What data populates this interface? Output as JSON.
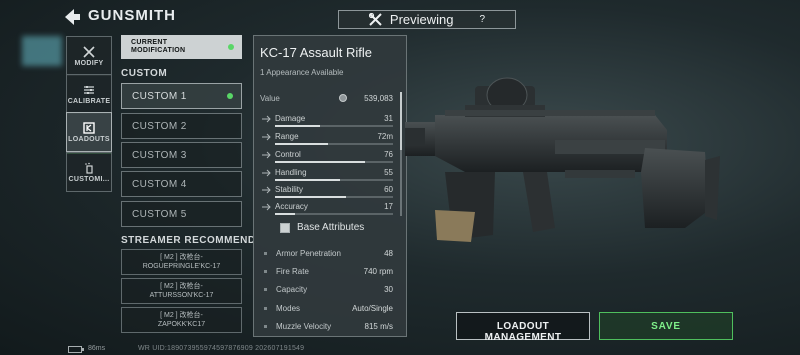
{
  "header": {
    "title": "GUNSMITH",
    "preview_label": "Previewing",
    "help_label": "?"
  },
  "nav": [
    {
      "label": "MODIFY",
      "icon": "wrench-icon"
    },
    {
      "label": "CALIBRATE",
      "icon": "sliders-icon"
    },
    {
      "label": "LOADOUTS",
      "icon": "loadout-icon"
    },
    {
      "label": "CUSTOMI...",
      "icon": "spray-icon"
    }
  ],
  "current_modification": {
    "line1": "CURRENT",
    "line2": "MODIFICATION"
  },
  "custom_section": {
    "label": "CUSTOM",
    "items": [
      "CUSTOM 1",
      "CUSTOM 2",
      "CUSTOM 3",
      "CUSTOM 4",
      "CUSTOM 5"
    ]
  },
  "streamer_section": {
    "label": "STREAMER RECOMMENDAT",
    "items": [
      {
        "line1": "[ M2 ] 改枪台-",
        "line2": "ROGUEPRINGLE'KC-17"
      },
      {
        "line1": "[ M2 ] 改枪台-",
        "line2": "ATTURSSON'KC-17"
      },
      {
        "line1": "[ M2 ] 改枪台-",
        "line2": "ZAPOKK'KC17"
      }
    ]
  },
  "weapon": {
    "name": "KC-17 Assault Rifle",
    "appearance": "1 Appearance Available",
    "value_label": "Value",
    "value": "539,083"
  },
  "stats": [
    {
      "name": "Damage",
      "value": "31",
      "fraction": 0.38,
      "icon": "damage-icon"
    },
    {
      "name": "Range",
      "value": "72m",
      "fraction": 0.45,
      "icon": "range-icon"
    },
    {
      "name": "Control",
      "value": "76",
      "fraction": 0.76,
      "icon": "control-icon"
    },
    {
      "name": "Handling",
      "value": "55",
      "fraction": 0.55,
      "icon": "handling-icon"
    },
    {
      "name": "Stability",
      "value": "60",
      "fraction": 0.6,
      "icon": "stability-icon"
    },
    {
      "name": "Accuracy",
      "value": "17",
      "fraction": 0.17,
      "icon": "accuracy-icon"
    }
  ],
  "base_attributes": {
    "label": "Base Attributes",
    "items": [
      {
        "name": "Armor Penetration",
        "value": "48"
      },
      {
        "name": "Fire Rate",
        "value": "740 rpm"
      },
      {
        "name": "Capacity",
        "value": "30"
      },
      {
        "name": "Modes",
        "value": "Auto/Single"
      },
      {
        "name": "Muzzle Velocity",
        "value": "815 m/s"
      }
    ]
  },
  "buttons": {
    "loadout_management": "LOADOUT MANAGEMENT",
    "save": "SAVE"
  },
  "footer": {
    "ping": "86ms",
    "uid": "WR UID:189073955974597876909 202607191549"
  },
  "colors": {
    "accent_green": "#59d667",
    "save_text": "#7ff08a"
  }
}
